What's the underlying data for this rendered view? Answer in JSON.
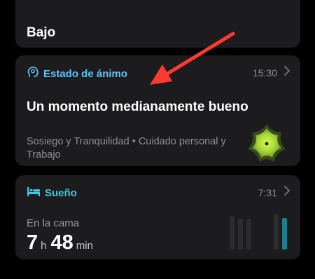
{
  "top_card": {
    "title": "Bajo"
  },
  "mood_card": {
    "section_label": "Estado de ánimo",
    "time": "15:30",
    "title": "Un momento medianamente bueno",
    "tags": "Sosiego y Tranquilidad • Cuidado personal y Trabajo",
    "icon": "head-emotion-icon",
    "badge_icon": "mood-flower-badge",
    "accent_color": "#5ac8fa",
    "badge_color": "#b6e03a"
  },
  "sleep_card": {
    "section_label": "Sueño",
    "time": "7:31",
    "icon": "bed-icon",
    "label": "En la cama",
    "hours": "7",
    "hours_unit": "h",
    "minutes": "48",
    "minutes_unit": "min",
    "accent_color": "#40c8e0"
  },
  "annotation": {
    "arrow_color": "#ff3b30"
  }
}
